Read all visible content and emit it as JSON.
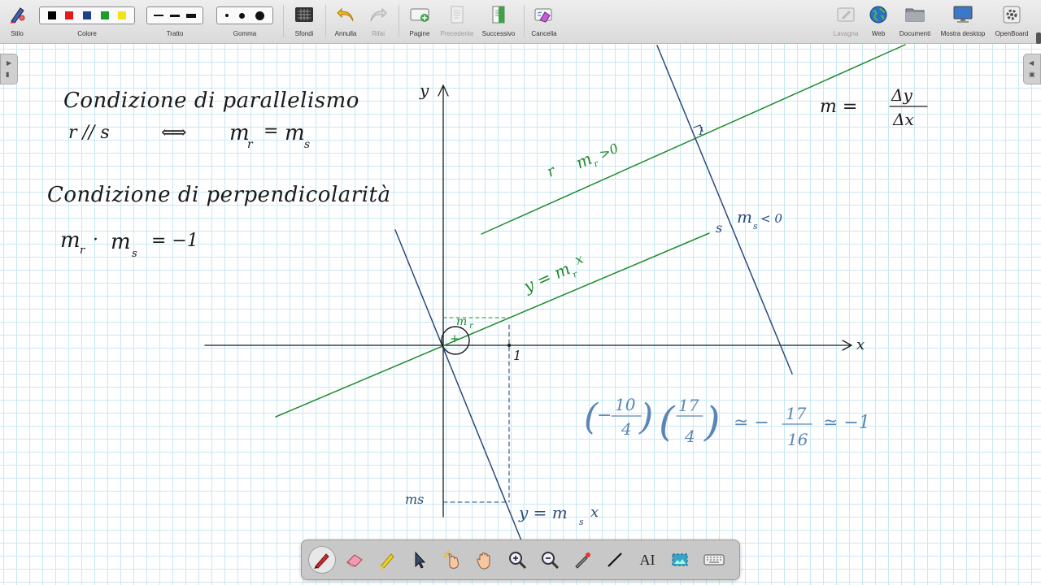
{
  "toolbar": {
    "stylus": {
      "label": "Stilo",
      "icon": "stylus-icon"
    },
    "color": {
      "label": "Colore",
      "swatches": [
        "#000000",
        "#e31a1c",
        "#1f3f8f",
        "#1e9a2f",
        "#f3e21a"
      ]
    },
    "stroke": {
      "label": "Tratto"
    },
    "eraser": {
      "label": "Gomma"
    },
    "backgrounds": {
      "label": "Sfondi",
      "icon": "background-icon"
    },
    "undo": {
      "label": "Annulla",
      "icon": "undo-icon"
    },
    "redo": {
      "label": "Rifai",
      "icon": "redo-icon"
    },
    "pages": {
      "label": "Pagine",
      "icon": "pages-icon"
    },
    "previous": {
      "label": "Precedente",
      "icon": "previous-page-icon"
    },
    "next": {
      "label": "Successivo",
      "icon": "next-page-icon"
    },
    "clear": {
      "label": "Cancella",
      "icon": "clear-icon"
    },
    "board": {
      "label": "Lavagna",
      "icon": "board-icon"
    },
    "web": {
      "label": "Web",
      "icon": "globe-icon"
    },
    "documents": {
      "label": "Documenti",
      "icon": "folder-icon"
    },
    "desktop": {
      "label": "Mostra desktop",
      "icon": "monitor-icon"
    },
    "openboard": {
      "label": "OpenBoard",
      "icon": "settings-icon"
    }
  },
  "dock": {
    "tools": [
      "pen-icon",
      "eraser-icon",
      "highlighter-icon",
      "pointer-icon",
      "laser-hand-icon",
      "hand-icon",
      "zoom-in-icon",
      "zoom-out-icon",
      "laser-pointer-icon",
      "line-icon",
      "text-tool-icon",
      "capture-icon",
      "keyboard-icon"
    ],
    "text_tool_label": "AI"
  },
  "colors": {
    "ink_black": "#1a1a1a",
    "ink_blue": "#2b4a7a",
    "ink_green": "#1f8a2c",
    "math_blue": "#5b86b4",
    "grid": "#c9e8f2"
  },
  "handwriting": {
    "parallel_title": "Condizione di parallelismo",
    "parallel_r": "r // s",
    "parallel_iff": "⟺",
    "parallel_mr": "m",
    "parallel_mr_sub": "r",
    "parallel_eq": "=",
    "parallel_ms": "m",
    "parallel_ms_sub": "s",
    "perp_title": "Condizione di perpendicolarità",
    "perp_mr": "m",
    "perp_mr_sub": "r",
    "perp_dot": "·",
    "perp_ms": "m",
    "perp_ms_sub": "s",
    "perp_rhs": "= −1",
    "slope_m": "m =",
    "slope_num": "Δy",
    "slope_den": "Δx",
    "axis_y": "y",
    "axis_x": "x",
    "line_r": "r",
    "line_r_slope": "m",
    "line_r_slope_sub": "r",
    "line_r_slope_cond": ">0",
    "line_s": "s",
    "line_s_slope": "m",
    "line_s_slope_sub": "s",
    "line_s_slope_cond": "< 0",
    "eq_green": "y = m",
    "eq_green_sub": "r",
    "eq_green_x": "x",
    "eq_blue": "y = m",
    "eq_blue_sub": "s",
    "eq_blue_x": "x",
    "tick_one": "1",
    "mr_small": "m",
    "mr_small_sub": "r",
    "ms_label": "ms",
    "calc_lp1": "(",
    "calc_minus": "−",
    "calc_num1": "10",
    "calc_den1": "4",
    "calc_rp1": ")",
    "calc_lp2": "(",
    "calc_num2": "17",
    "calc_den2": "4",
    "calc_rp2": ")",
    "calc_approx1": "≃ −",
    "calc_num3": "17",
    "calc_den3": "16",
    "calc_approx2": "≃ −1",
    "angle_mark": "1"
  }
}
